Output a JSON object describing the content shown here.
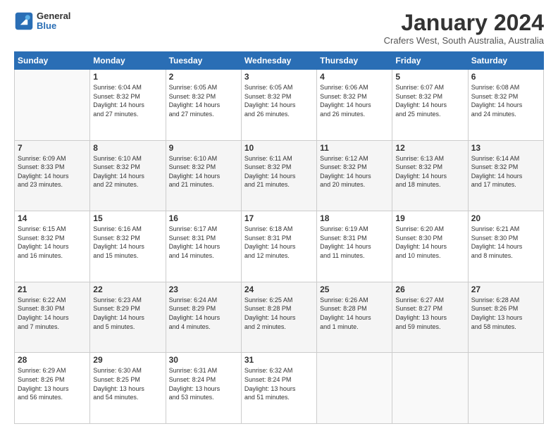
{
  "logo": {
    "line1": "General",
    "line2": "Blue"
  },
  "title": "January 2024",
  "subtitle": "Crafers West, South Australia, Australia",
  "days_header": [
    "Sunday",
    "Monday",
    "Tuesday",
    "Wednesday",
    "Thursday",
    "Friday",
    "Saturday"
  ],
  "weeks": [
    [
      {
        "day": "",
        "info": ""
      },
      {
        "day": "1",
        "info": "Sunrise: 6:04 AM\nSunset: 8:32 PM\nDaylight: 14 hours\nand 27 minutes."
      },
      {
        "day": "2",
        "info": "Sunrise: 6:05 AM\nSunset: 8:32 PM\nDaylight: 14 hours\nand 27 minutes."
      },
      {
        "day": "3",
        "info": "Sunrise: 6:05 AM\nSunset: 8:32 PM\nDaylight: 14 hours\nand 26 minutes."
      },
      {
        "day": "4",
        "info": "Sunrise: 6:06 AM\nSunset: 8:32 PM\nDaylight: 14 hours\nand 26 minutes."
      },
      {
        "day": "5",
        "info": "Sunrise: 6:07 AM\nSunset: 8:32 PM\nDaylight: 14 hours\nand 25 minutes."
      },
      {
        "day": "6",
        "info": "Sunrise: 6:08 AM\nSunset: 8:32 PM\nDaylight: 14 hours\nand 24 minutes."
      }
    ],
    [
      {
        "day": "7",
        "info": "Sunrise: 6:09 AM\nSunset: 8:33 PM\nDaylight: 14 hours\nand 23 minutes."
      },
      {
        "day": "8",
        "info": "Sunrise: 6:10 AM\nSunset: 8:32 PM\nDaylight: 14 hours\nand 22 minutes."
      },
      {
        "day": "9",
        "info": "Sunrise: 6:10 AM\nSunset: 8:32 PM\nDaylight: 14 hours\nand 21 minutes."
      },
      {
        "day": "10",
        "info": "Sunrise: 6:11 AM\nSunset: 8:32 PM\nDaylight: 14 hours\nand 21 minutes."
      },
      {
        "day": "11",
        "info": "Sunrise: 6:12 AM\nSunset: 8:32 PM\nDaylight: 14 hours\nand 20 minutes."
      },
      {
        "day": "12",
        "info": "Sunrise: 6:13 AM\nSunset: 8:32 PM\nDaylight: 14 hours\nand 18 minutes."
      },
      {
        "day": "13",
        "info": "Sunrise: 6:14 AM\nSunset: 8:32 PM\nDaylight: 14 hours\nand 17 minutes."
      }
    ],
    [
      {
        "day": "14",
        "info": "Sunrise: 6:15 AM\nSunset: 8:32 PM\nDaylight: 14 hours\nand 16 minutes."
      },
      {
        "day": "15",
        "info": "Sunrise: 6:16 AM\nSunset: 8:32 PM\nDaylight: 14 hours\nand 15 minutes."
      },
      {
        "day": "16",
        "info": "Sunrise: 6:17 AM\nSunset: 8:31 PM\nDaylight: 14 hours\nand 14 minutes."
      },
      {
        "day": "17",
        "info": "Sunrise: 6:18 AM\nSunset: 8:31 PM\nDaylight: 14 hours\nand 12 minutes."
      },
      {
        "day": "18",
        "info": "Sunrise: 6:19 AM\nSunset: 8:31 PM\nDaylight: 14 hours\nand 11 minutes."
      },
      {
        "day": "19",
        "info": "Sunrise: 6:20 AM\nSunset: 8:30 PM\nDaylight: 14 hours\nand 10 minutes."
      },
      {
        "day": "20",
        "info": "Sunrise: 6:21 AM\nSunset: 8:30 PM\nDaylight: 14 hours\nand 8 minutes."
      }
    ],
    [
      {
        "day": "21",
        "info": "Sunrise: 6:22 AM\nSunset: 8:30 PM\nDaylight: 14 hours\nand 7 minutes."
      },
      {
        "day": "22",
        "info": "Sunrise: 6:23 AM\nSunset: 8:29 PM\nDaylight: 14 hours\nand 5 minutes."
      },
      {
        "day": "23",
        "info": "Sunrise: 6:24 AM\nSunset: 8:29 PM\nDaylight: 14 hours\nand 4 minutes."
      },
      {
        "day": "24",
        "info": "Sunrise: 6:25 AM\nSunset: 8:28 PM\nDaylight: 14 hours\nand 2 minutes."
      },
      {
        "day": "25",
        "info": "Sunrise: 6:26 AM\nSunset: 8:28 PM\nDaylight: 14 hours\nand 1 minute."
      },
      {
        "day": "26",
        "info": "Sunrise: 6:27 AM\nSunset: 8:27 PM\nDaylight: 13 hours\nand 59 minutes."
      },
      {
        "day": "27",
        "info": "Sunrise: 6:28 AM\nSunset: 8:26 PM\nDaylight: 13 hours\nand 58 minutes."
      }
    ],
    [
      {
        "day": "28",
        "info": "Sunrise: 6:29 AM\nSunset: 8:26 PM\nDaylight: 13 hours\nand 56 minutes."
      },
      {
        "day": "29",
        "info": "Sunrise: 6:30 AM\nSunset: 8:25 PM\nDaylight: 13 hours\nand 54 minutes."
      },
      {
        "day": "30",
        "info": "Sunrise: 6:31 AM\nSunset: 8:24 PM\nDaylight: 13 hours\nand 53 minutes."
      },
      {
        "day": "31",
        "info": "Sunrise: 6:32 AM\nSunset: 8:24 PM\nDaylight: 13 hours\nand 51 minutes."
      },
      {
        "day": "",
        "info": ""
      },
      {
        "day": "",
        "info": ""
      },
      {
        "day": "",
        "info": ""
      }
    ]
  ]
}
